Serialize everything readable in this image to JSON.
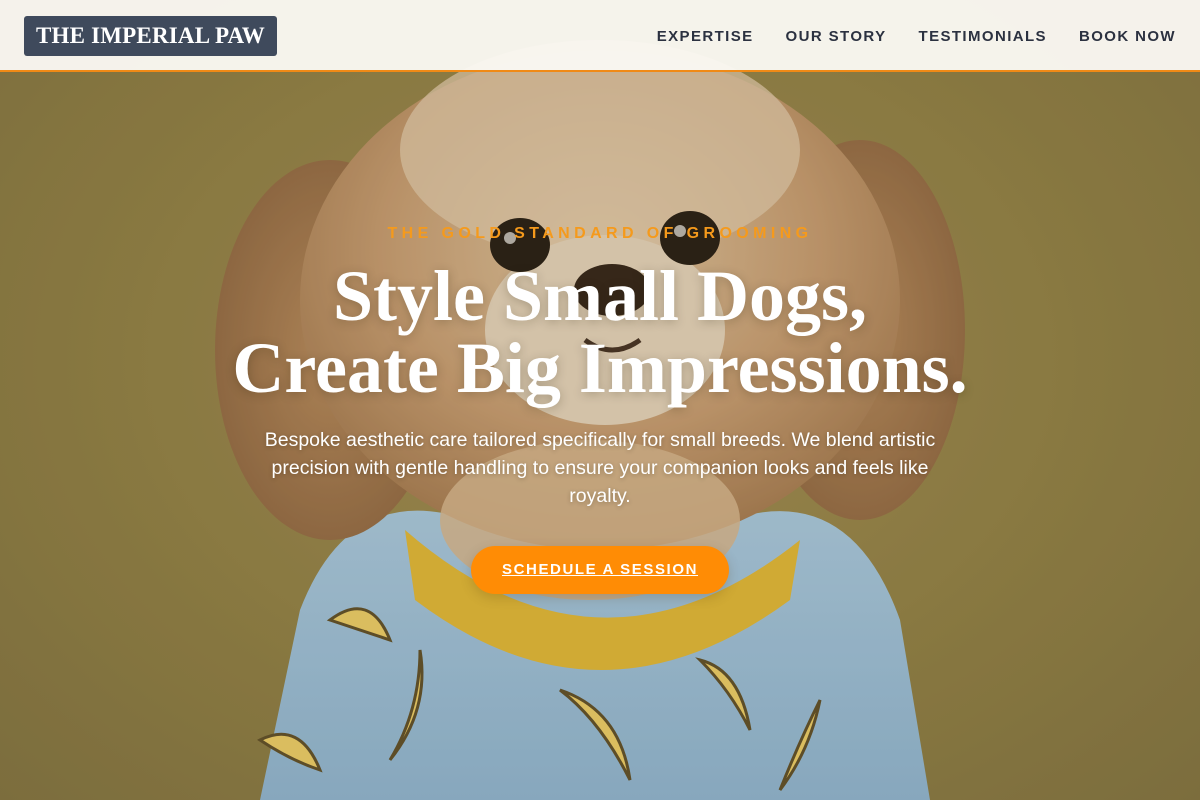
{
  "brand": {
    "name": "THE IMPERIAL PAW"
  },
  "nav": {
    "items": [
      {
        "label": "EXPERTISE"
      },
      {
        "label": "OUR STORY"
      },
      {
        "label": "TESTIMONIALS"
      },
      {
        "label": "BOOK NOW"
      }
    ]
  },
  "hero": {
    "eyebrow": "THE GOLD STANDARD OF GROOMING",
    "headline_line1": "Style Small Dogs,",
    "headline_line2": "Create Big Impressions.",
    "description": "Bespoke aesthetic care tailored specifically for small breeds. We blend artistic precision with gentle handling to ensure your companion looks and feels like royalty.",
    "cta_label": "SCHEDULE A SESSION",
    "image_alt": "small fluffy dog wearing a blue banana-print shirt"
  },
  "colors": {
    "accent": "#ff8c05",
    "eyebrow": "#f59a1c",
    "logo_bg": "#3f4a5c",
    "nav_text": "#2b3140",
    "background": "#8f8046"
  }
}
